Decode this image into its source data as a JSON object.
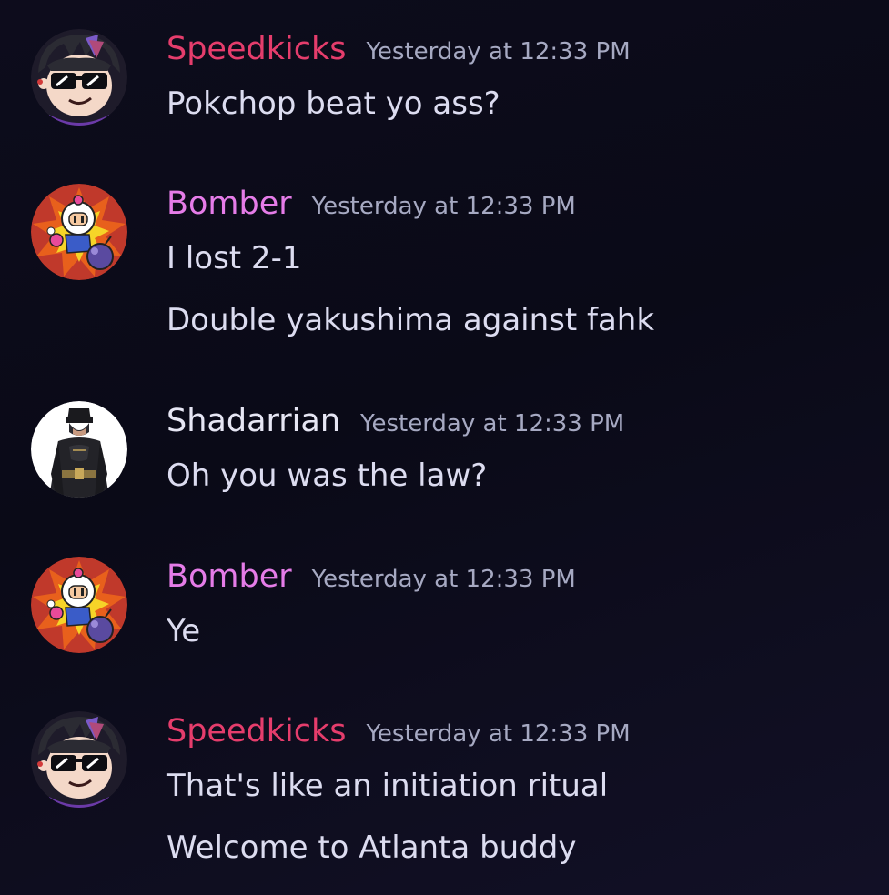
{
  "colors": {
    "speedkicks": "#e53d6c",
    "bomber": "#e57ce8",
    "shadarrian": "#e6e6f4",
    "timestamp": "#a6a9c2",
    "text": "#dcdcf0"
  },
  "messages": [
    {
      "author": "Speedkicks",
      "timestamp": "Yesterday at 12:33 PM",
      "avatar_icon": "anime-sunglasses-avatar-icon",
      "lines": [
        "Pokchop beat yo ass?"
      ]
    },
    {
      "author": "Bomber",
      "timestamp": "Yesterday at 12:33 PM",
      "avatar_icon": "bomberman-avatar-icon",
      "lines": [
        "I lost 2-1",
        "Double yakushima against fahk"
      ]
    },
    {
      "author": "Shadarrian",
      "timestamp": "Yesterday at 12:33 PM",
      "avatar_icon": "batman-avatar-icon",
      "lines": [
        "Oh you was the law?"
      ]
    },
    {
      "author": "Bomber",
      "timestamp": "Yesterday at 12:33 PM",
      "avatar_icon": "bomberman-avatar-icon",
      "lines": [
        "Ye"
      ]
    },
    {
      "author": "Speedkicks",
      "timestamp": "Yesterday at 12:33 PM",
      "avatar_icon": "anime-sunglasses-avatar-icon",
      "lines": [
        "That's like an initiation ritual",
        "Welcome to Atlanta buddy"
      ]
    }
  ]
}
